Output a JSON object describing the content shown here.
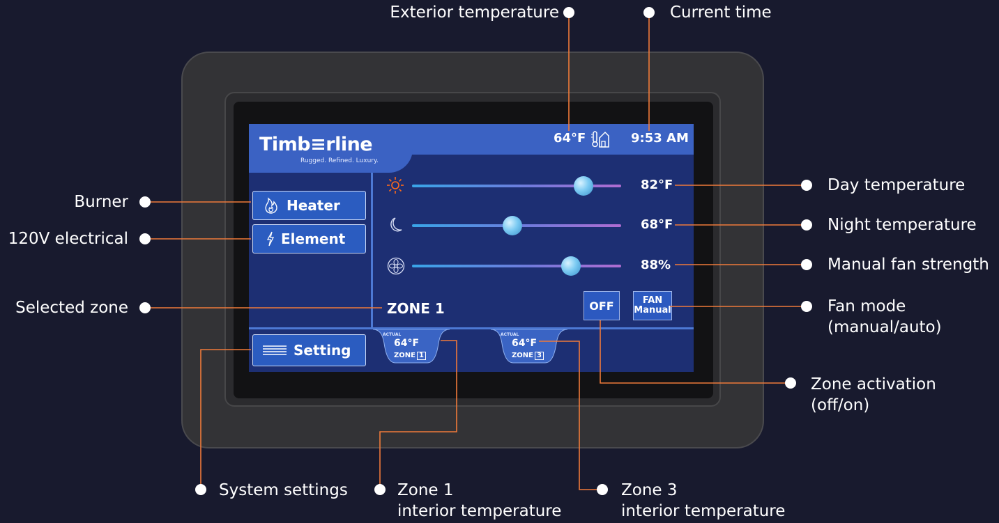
{
  "callouts": {
    "exterior_temperature": "Exterior temperature",
    "current_time": "Current time",
    "burner": "Burner",
    "electrical": "120V electrical",
    "selected_zone": "Selected zone",
    "day_temperature": "Day temperature",
    "night_temperature": "Night temperature",
    "manual_fan_strength": "Manual fan strength",
    "fan_mode_line1": "Fan mode",
    "fan_mode_line2": "(manual/auto)",
    "zone_activation_line1": "Zone activation",
    "zone_activation_line2": "(off/on)",
    "system_settings": "System settings",
    "zone1_line1": "Zone 1",
    "zone1_line2": "interior temperature",
    "zone3_line1": "Zone 3",
    "zone3_line2": "interior temperature"
  },
  "screen": {
    "brand": "Timb≡rline",
    "tagline": "Rugged. Refined. Luxury.",
    "exterior_temp": "64°F",
    "time": "9:53 AM",
    "buttons": {
      "heater": "Heater",
      "element": "Element",
      "setting": "Setting"
    },
    "sliders": [
      {
        "icon": "sun-icon",
        "value_label": "82°F",
        "level": 0.82
      },
      {
        "icon": "moon-icon",
        "value_label": "68°F",
        "level": 0.48
      },
      {
        "icon": "fan-icon",
        "value_label": "88%",
        "level": 0.76
      }
    ],
    "selected_zone": "ZONE 1",
    "zone_toggle": "OFF",
    "fan_mode_top": "FAN",
    "fan_mode_bottom": "Manual",
    "zone_tabs": [
      {
        "actual": "ACTUAL",
        "temp": "64°F",
        "zone": "ZONE",
        "num": "1"
      },
      {
        "actual": "ACTUAL",
        "temp": "64°F",
        "zone": "ZONE",
        "num": "3"
      }
    ]
  },
  "colors": {
    "background": "#181a2e",
    "screen": "#1d2f73",
    "accent_line": "#f07a3a",
    "button": "#2b5cc0"
  }
}
